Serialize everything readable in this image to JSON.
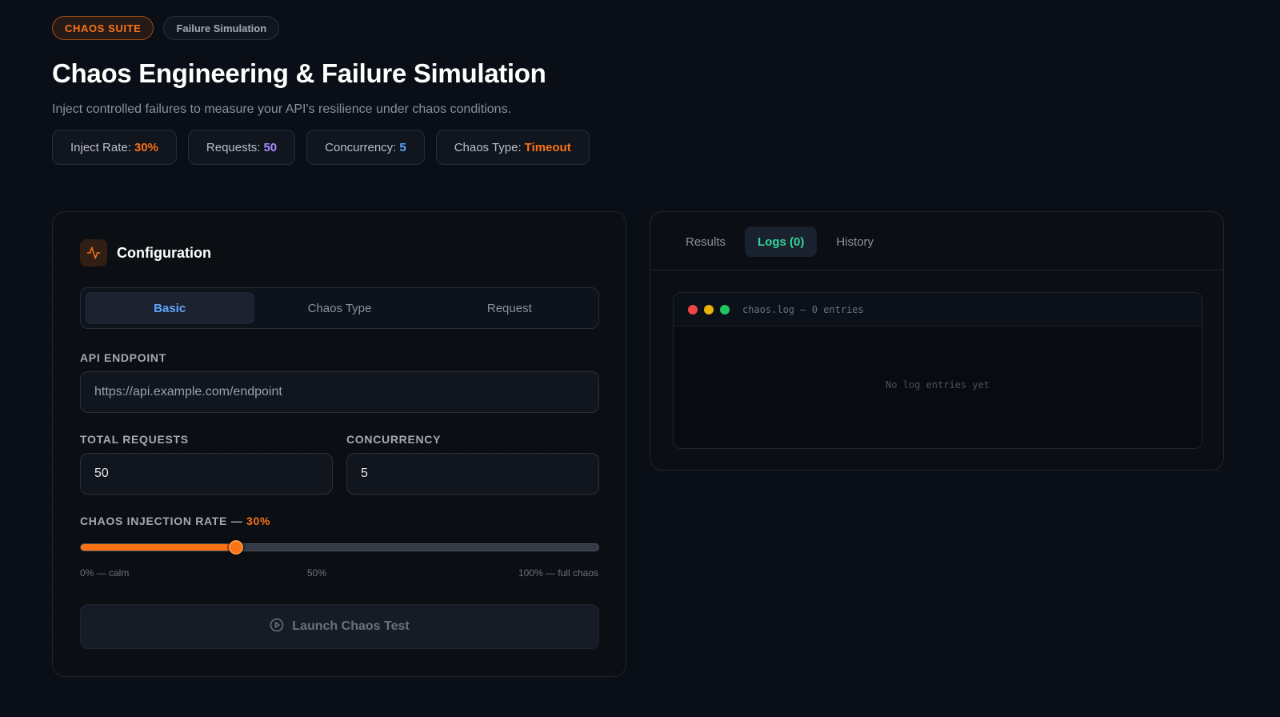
{
  "header": {
    "badge_primary": "CHAOS SUITE",
    "badge_secondary": "Failure Simulation",
    "title": "Chaos Engineering & Failure Simulation",
    "subtitle": "Inject controlled failures to measure your API's resilience under chaos conditions."
  },
  "stats": [
    {
      "label": "Inject Rate:",
      "value": "30%",
      "color": "#f97316"
    },
    {
      "label": "Requests:",
      "value": "50",
      "color": "#a78bfa"
    },
    {
      "label": "Concurrency:",
      "value": "5",
      "color": "#60a5fa"
    },
    {
      "label": "Chaos Type:",
      "value": "Timeout",
      "color": "#f97316"
    }
  ],
  "config": {
    "title": "Configuration",
    "icon": "activity-icon",
    "tabs": [
      {
        "label": "Basic",
        "active": true
      },
      {
        "label": "Chaos Type",
        "active": false
      },
      {
        "label": "Request",
        "active": false
      }
    ],
    "endpoint": {
      "label": "API ENDPOINT",
      "placeholder": "https://api.example.com/endpoint",
      "value": ""
    },
    "total_requests": {
      "label": "TOTAL REQUESTS",
      "value": "50"
    },
    "concurrency": {
      "label": "CONCURRENCY",
      "value": "5"
    },
    "rate": {
      "label": "CHAOS INJECTION RATE",
      "separator": "—",
      "value_text": "30%",
      "value": 30,
      "min": 0,
      "max": 100
    },
    "ticks": {
      "min": "0% — calm",
      "mid": "50%",
      "max": "100% — full chaos"
    },
    "launch": {
      "label": "Launch Chaos Test",
      "icon": "play-circle-icon"
    }
  },
  "results": {
    "tabs": [
      {
        "label": "Results",
        "active": false
      },
      {
        "label": "Logs (0)",
        "active": true
      },
      {
        "label": "History",
        "active": false
      }
    ],
    "terminal": {
      "title": "chaos.log — 0 entries",
      "empty": "No log entries yet",
      "dots": [
        "#ef4444",
        "#eab308",
        "#22c55e"
      ]
    }
  },
  "colors": {
    "accent": "#f97316",
    "active_tab": "#60a5fa",
    "logs_tab": "#34d399"
  }
}
